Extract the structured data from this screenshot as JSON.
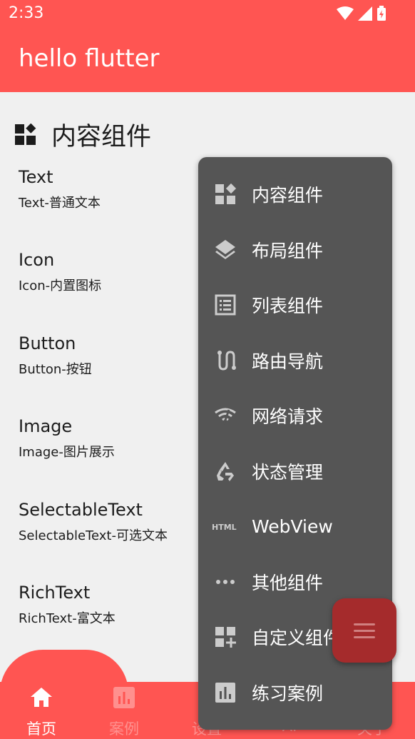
{
  "status": {
    "time": "2:33"
  },
  "app": {
    "title": "hello flutter"
  },
  "section": {
    "title": "内容组件"
  },
  "items": [
    {
      "title": "Text",
      "subtitle": "Text-普通文本"
    },
    {
      "title": "Icon",
      "subtitle": "Icon-内置图标"
    },
    {
      "title": "Button",
      "subtitle": "Button-按钮"
    },
    {
      "title": "Image",
      "subtitle": "Image-图片展示"
    },
    {
      "title": "SelectableText",
      "subtitle": "SelectableText-可选文本"
    },
    {
      "title": "RichText",
      "subtitle": "RichText-富文本"
    }
  ],
  "menu": [
    {
      "label": "内容组件",
      "icon": "widgets-icon"
    },
    {
      "label": "布局组件",
      "icon": "layers-icon"
    },
    {
      "label": "列表组件",
      "icon": "list-icon"
    },
    {
      "label": "路由导航",
      "icon": "route-icon"
    },
    {
      "label": "网络请求",
      "icon": "wifi-icon"
    },
    {
      "label": "状态管理",
      "icon": "recycle-icon"
    },
    {
      "label": "WebView",
      "icon": "html-icon"
    },
    {
      "label": "其他组件",
      "icon": "more-icon"
    },
    {
      "label": "自定义组件",
      "icon": "dashboard-add-icon"
    },
    {
      "label": "练习案例",
      "icon": "bar-chart-icon"
    }
  ],
  "nav": [
    {
      "label": "首页",
      "icon": "home-icon"
    },
    {
      "label": "案例",
      "icon": "bar-chart-icon"
    },
    {
      "label": "设置",
      "icon": "gear-icon"
    },
    {
      "label": "AI",
      "icon": "chat-icon"
    },
    {
      "label": "关于",
      "icon": "info-icon"
    }
  ],
  "colors": {
    "primary": "#ff5552",
    "menu_bg": "#555555",
    "fab": "#a52b2c"
  }
}
